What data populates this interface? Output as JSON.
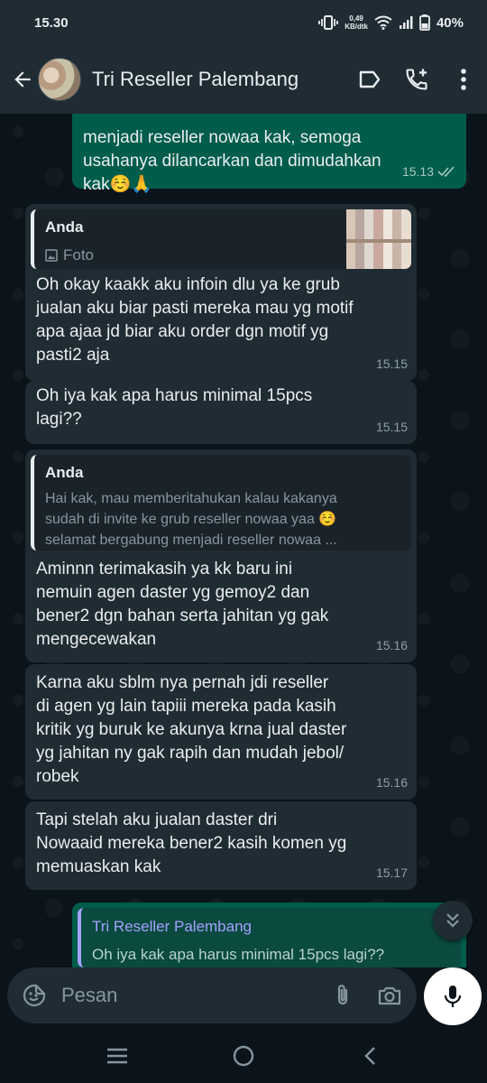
{
  "status_bar": {
    "time": "15.30",
    "net_speed_value": "0,49",
    "net_speed_unit": "KB/dtk",
    "battery": "40%"
  },
  "header": {
    "contact_name": "Tri Reseller Palembang",
    "icons": [
      "back-arrow-icon",
      "label-icon",
      "add-call-icon",
      "more-vert-icon"
    ]
  },
  "messages": [
    {
      "id": "m1",
      "direction": "out",
      "partial_text": "menjadi reseller nowaa kak, semoga",
      "text": "usahanya dilancarkan dan dimudahkan\nkak☺️🙏",
      "time": "15.13",
      "status": "read"
    },
    {
      "id": "m2",
      "direction": "in",
      "quote": {
        "author": "Anda",
        "sub_label": "Foto",
        "has_thumbnail": true
      },
      "text": "Oh okay kaakk aku infoin dlu ya ke grub\njualan aku biar pasti mereka mau yg motif\napa ajaa jd biar aku order dgn motif yg\npasti2 aja",
      "time": "15.15"
    },
    {
      "id": "m3",
      "direction": "in",
      "text": "Oh iya kak apa harus minimal 15pcs\nlagi??",
      "time": "15.15"
    },
    {
      "id": "m4",
      "direction": "in",
      "quote": {
        "author": "Anda",
        "text": "Hai kak, mau memberitahukan kalau kakanya\nsudah di invite ke grub reseller nowaa yaa ☺️\nselamat bergabung menjadi reseller nowaa ..."
      },
      "text": "Aminnn terimakasih ya kk baru ini\nnemuin agen daster yg gemoy2 dan\nbener2 dgn bahan serta jahitan yg gak\nmengecewakan",
      "time": "15.16"
    },
    {
      "id": "m5",
      "direction": "in",
      "text": "Karna aku sblm nya pernah jdi reseller\ndi agen yg lain tapiii mereka pada kasih\nkritik yg buruk ke akunya krna jual daster\nyg jahitan ny gak rapih dan mudah jebol/\nrobek",
      "time": "15.16"
    },
    {
      "id": "m6",
      "direction": "in",
      "text": "Tapi stelah aku jualan daster dri\nNowaaid mereka bener2 kasih komen yg\nmemuaskan kak",
      "time": "15.17"
    },
    {
      "id": "m7",
      "direction": "out",
      "quote": {
        "author": "Tri Reseller Palembang",
        "text": "Oh iya kak apa harus minimal 15pcs lagi??"
      }
    }
  ],
  "input": {
    "placeholder": "Pesan"
  },
  "colors": {
    "background": "#0b141a",
    "header": "#1f2c34",
    "incoming_bubble": "#202c33",
    "outgoing_bubble": "#005c4b",
    "quote_accent_out": "#a5a1ff"
  }
}
